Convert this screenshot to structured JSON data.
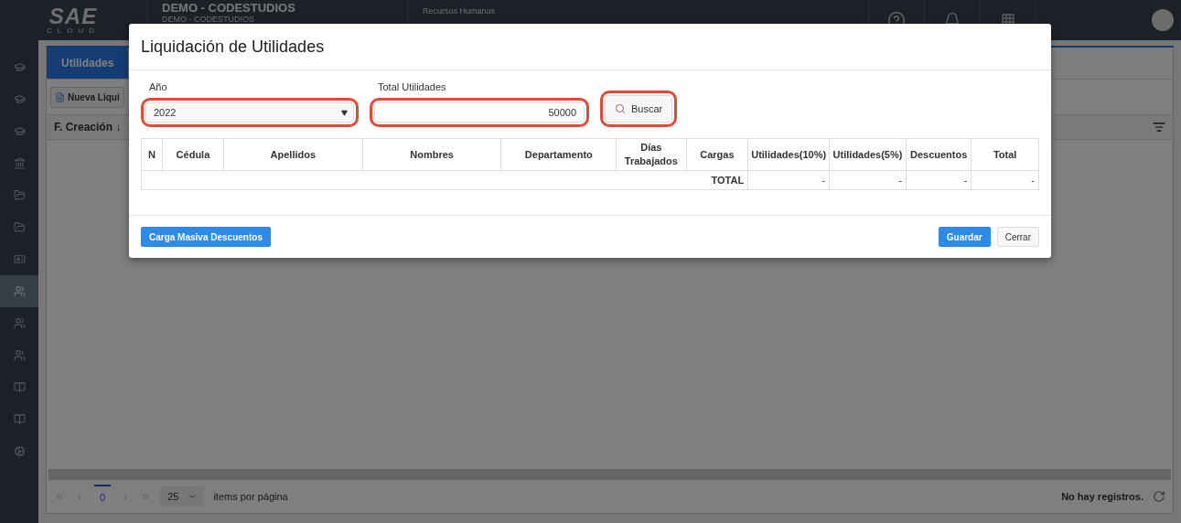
{
  "app": {
    "logo": {
      "text": "SAE",
      "subtext": "CLOUD"
    },
    "company": {
      "name": "DEMO - CODESTUDIOS",
      "subname": "DEMO - CODESTUDIOS"
    },
    "module": {
      "section": "Recursos Humanos"
    }
  },
  "sidebar": {
    "items": [
      {
        "kind": "cap",
        "selected": false
      },
      {
        "kind": "cap",
        "selected": false
      },
      {
        "kind": "cap",
        "selected": false
      },
      {
        "kind": "bank",
        "selected": false
      },
      {
        "kind": "folder",
        "selected": false
      },
      {
        "kind": "folder",
        "selected": false
      },
      {
        "kind": "card",
        "selected": false
      },
      {
        "kind": "people",
        "selected": true
      },
      {
        "kind": "people",
        "selected": false
      },
      {
        "kind": "people",
        "selected": false
      },
      {
        "kind": "book",
        "selected": false
      },
      {
        "kind": "book",
        "selected": false
      },
      {
        "kind": "gears",
        "selected": false
      }
    ]
  },
  "tabs": [
    {
      "label": "Utilidades",
      "selected": true
    }
  ],
  "toolbar": {
    "button": "Nueva Liqui"
  },
  "grid": {
    "columns": [
      {
        "label": "F. Creación",
        "sort": "↓"
      }
    ],
    "pager": {
      "page": "0",
      "page_size": "25",
      "page_size_label": "items por página",
      "status": "No hay registros."
    }
  },
  "modal": {
    "title": "Liquidación de Utilidades",
    "year": {
      "label": "Año",
      "value": "2022",
      "highlighted": true
    },
    "total": {
      "label": "Total Utilidades",
      "value": "50000",
      "highlighted": true
    },
    "search_button": {
      "label": "Buscar",
      "highlighted": true
    },
    "table": {
      "columns": [
        "N",
        "Cédula",
        "Apellidos",
        "Nombres",
        "Departamento",
        "Días Trabajados",
        "Cargas",
        "Utilidades(10%)",
        "Utilidades(5%)",
        "Descuentos",
        "Total"
      ],
      "total_row": {
        "label": "TOTAL",
        "values": [
          "-",
          "-",
          "-",
          "-"
        ]
      }
    },
    "buttons": {
      "bulk": "Carga Masiva Descuentos",
      "save": "Guardar",
      "close": "Cerrar"
    }
  }
}
